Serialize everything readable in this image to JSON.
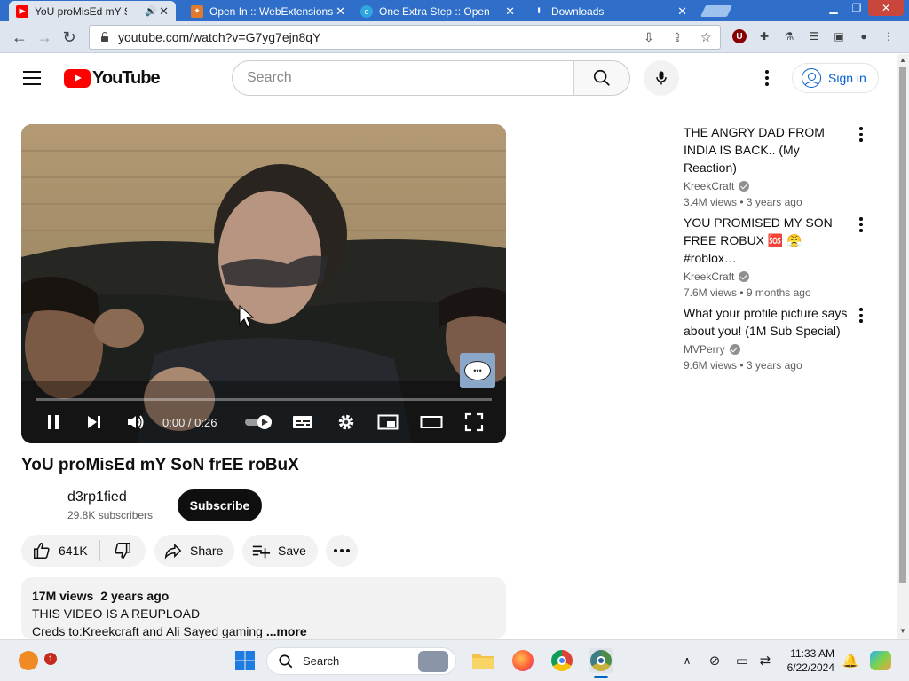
{
  "browser": {
    "tabs": [
      {
        "label": "YoU proMisEd mY SoN frEE roBuX - YouTube",
        "active": true,
        "icon": "youtube-favicon"
      },
      {
        "label": "Open In :: WebExtensions",
        "active": false,
        "icon": "puzzle-favicon"
      },
      {
        "label": "One Extra Step :: Open",
        "active": false,
        "icon": "edge-favicon"
      },
      {
        "label": "Downloads",
        "active": false,
        "icon": "download-favicon"
      }
    ],
    "url": "youtube.com/watch?v=G7yg7ejn8qY"
  },
  "youtube": {
    "logo_text": "YouTube",
    "search_placeholder": "Search",
    "signin_label": "Sign in"
  },
  "player": {
    "timecode": "0:00 / 0:26",
    "progress": 0.0,
    "state": "playing"
  },
  "video": {
    "title": "YoU proMisEd mY SoN frEE roBuX",
    "channel": "d3rp1fied",
    "subscribers": "29.8K subscribers",
    "subscribe_label": "Subscribe",
    "likes": "641K",
    "share_label": "Share",
    "save_label": "Save",
    "views": "17M views",
    "age": "2 years ago",
    "description_line1": "THIS VIDEO IS A REUPLOAD",
    "description_line2": "Creds to:Kreekcraft and Ali Sayed gaming ",
    "more_label": "...more"
  },
  "recommendations": [
    {
      "title": "THE ANGRY DAD FROM INDIA IS BACK.. (My Reaction)",
      "channel": "KreekCraft",
      "views": "3.4M views",
      "age": "3 years ago"
    },
    {
      "title": "YOU PROMISED MY SON FREE ROBUX 🆘 😤 #roblox…",
      "channel": "KreekCraft",
      "views": "7.6M views",
      "age": "9 months ago"
    },
    {
      "title": "What your profile picture says about you! (1M Sub Special)",
      "channel": "MVPerry",
      "views": "9.6M views",
      "age": "3 years ago"
    }
  ],
  "taskbar": {
    "search_label": "Search",
    "time": "11:33 AM",
    "date": "6/22/2024",
    "notification_count": "1"
  },
  "colors": {
    "brand_red": "#ff0000",
    "link_blue": "#065fd4",
    "tab_strip": "#2f6fc9"
  }
}
